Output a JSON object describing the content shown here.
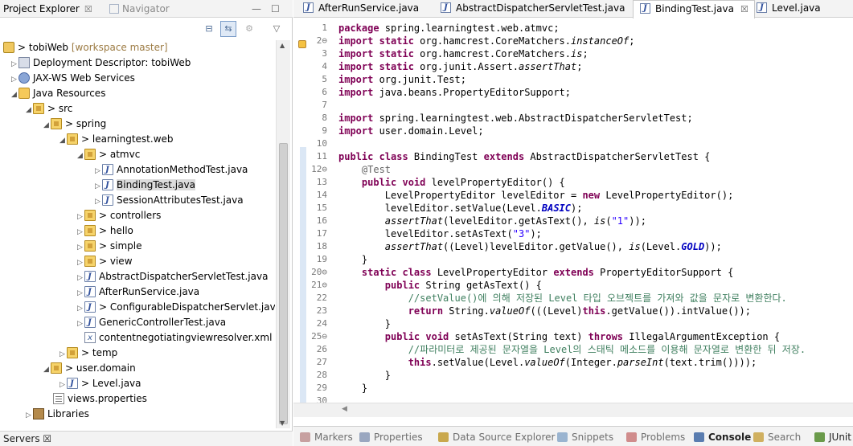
{
  "left_panel": {
    "tabs": [
      {
        "label": "Project Explorer",
        "close": "☒"
      },
      {
        "label": "Navigator"
      }
    ],
    "window_buttons": [
      "—",
      "☐"
    ],
    "tree": [
      {
        "label": "tobiWeb",
        "extra": "[workspace master]",
        "prefix": "> "
      },
      {
        "label": "Deployment Descriptor: tobiWeb"
      },
      {
        "label": "JAX-WS Web Services"
      },
      {
        "label": "Java Resources"
      },
      {
        "label": "src",
        "prefix": "> "
      },
      {
        "label": "spring",
        "prefix": "> "
      },
      {
        "label": "learningtest.web",
        "prefix": "> "
      },
      {
        "label": "atmvc",
        "prefix": "> "
      },
      {
        "label": "AnnotationMethodTest.java"
      },
      {
        "label": "BindingTest.java"
      },
      {
        "label": "SessionAttributesTest.java"
      },
      {
        "label": "controllers",
        "prefix": "> "
      },
      {
        "label": "hello",
        "prefix": "> "
      },
      {
        "label": "simple",
        "prefix": "> "
      },
      {
        "label": "view",
        "prefix": "> "
      },
      {
        "label": "AbstractDispatcherServletTest.java"
      },
      {
        "label": "AfterRunService.java"
      },
      {
        "label": "ConfigurableDispatcherServlet.java",
        "prefix": "> "
      },
      {
        "label": "GenericControllerTest.java"
      },
      {
        "label": "contentnegotiatingviewresolver.xml"
      },
      {
        "label": "temp",
        "prefix": "> "
      },
      {
        "label": "user.domain",
        "prefix": "> "
      },
      {
        "label": "Level.java",
        "prefix": "> "
      },
      {
        "label": "views.properties"
      },
      {
        "label": "Libraries"
      }
    ],
    "servers_tab": "Servers ☒"
  },
  "editor": {
    "tabs": [
      {
        "label": "AfterRunService.java"
      },
      {
        "label": "AbstractDispatcherServletTest.java"
      },
      {
        "label": "BindingTest.java",
        "close": "☒"
      },
      {
        "label": "Level.java"
      }
    ],
    "lines": [
      {
        "n": "1",
        "c": [
          [
            "kw",
            "package"
          ],
          [
            "t",
            " spring.learningtest.web.atmvc;"
          ]
        ]
      },
      {
        "n": "2⊖",
        "c": [
          [
            "kw",
            "import static"
          ],
          [
            "t",
            " org.hamcrest.CoreMatchers."
          ],
          [
            "it",
            "instanceOf"
          ],
          [
            "t",
            ";"
          ]
        ]
      },
      {
        "n": "3",
        "c": [
          [
            "kw",
            "import static"
          ],
          [
            "t",
            " org.hamcrest.CoreMatchers."
          ],
          [
            "it",
            "is"
          ],
          [
            "t",
            ";"
          ]
        ]
      },
      {
        "n": "4",
        "c": [
          [
            "kw",
            "import static"
          ],
          [
            "t",
            " org.junit.Assert."
          ],
          [
            "it",
            "assertThat"
          ],
          [
            "t",
            ";"
          ]
        ]
      },
      {
        "n": "5",
        "c": [
          [
            "kw",
            "import"
          ],
          [
            "t",
            " org.junit.Test;"
          ]
        ]
      },
      {
        "n": "6",
        "c": [
          [
            "kw",
            "import"
          ],
          [
            "t",
            " java.beans.PropertyEditorSupport;"
          ]
        ]
      },
      {
        "n": "7",
        "c": []
      },
      {
        "n": "8",
        "c": [
          [
            "kw",
            "import"
          ],
          [
            "t",
            " spring.learningtest.web.AbstractDispatcherServletTest;"
          ]
        ]
      },
      {
        "n": "9",
        "c": [
          [
            "kw",
            "import"
          ],
          [
            "t",
            " user.domain.Level;"
          ]
        ]
      },
      {
        "n": "10",
        "c": []
      },
      {
        "n": "11",
        "c": [
          [
            "kw",
            "public class"
          ],
          [
            "t",
            " BindingTest "
          ],
          [
            "kw",
            "extends"
          ],
          [
            "t",
            " AbstractDispatcherServletTest {"
          ]
        ]
      },
      {
        "n": "12⊖",
        "c": [
          [
            "t",
            "    "
          ],
          [
            "ann",
            "@Test"
          ]
        ]
      },
      {
        "n": "13",
        "c": [
          [
            "t",
            "    "
          ],
          [
            "kw",
            "public void"
          ],
          [
            "t",
            " levelPropertyEditor() {"
          ]
        ]
      },
      {
        "n": "14",
        "c": [
          [
            "t",
            "        LevelPropertyEditor levelEditor = "
          ],
          [
            "kw",
            "new"
          ],
          [
            "t",
            " LevelPropertyEditor();"
          ]
        ]
      },
      {
        "n": "15",
        "c": [
          [
            "t",
            "        levelEditor.setValue(Level."
          ],
          [
            "fld",
            "BASIC"
          ],
          [
            "t",
            ");"
          ]
        ]
      },
      {
        "n": "16",
        "c": [
          [
            "t",
            "        "
          ],
          [
            "it",
            "assertThat"
          ],
          [
            "t",
            "(levelEditor.getAsText(), "
          ],
          [
            "it",
            "is"
          ],
          [
            "t",
            "("
          ],
          [
            "str",
            "\"1\""
          ],
          [
            "t",
            "));"
          ]
        ]
      },
      {
        "n": "17",
        "c": [
          [
            "t",
            "        levelEditor.setAsText("
          ],
          [
            "str",
            "\"3\""
          ],
          [
            "t",
            ");"
          ]
        ]
      },
      {
        "n": "18",
        "c": [
          [
            "t",
            "        "
          ],
          [
            "it",
            "assertThat"
          ],
          [
            "t",
            "((Level)levelEditor.getValue(), "
          ],
          [
            "it",
            "is"
          ],
          [
            "t",
            "(Level."
          ],
          [
            "fld",
            "GOLD"
          ],
          [
            "t",
            "));"
          ]
        ]
      },
      {
        "n": "19",
        "c": [
          [
            "t",
            "    }"
          ]
        ]
      },
      {
        "n": "20⊖",
        "c": [
          [
            "t",
            "    "
          ],
          [
            "kw",
            "static class"
          ],
          [
            "t",
            " LevelPropertyEditor "
          ],
          [
            "kw",
            "extends"
          ],
          [
            "t",
            " PropertyEditorSupport {"
          ]
        ]
      },
      {
        "n": "21⊖",
        "c": [
          [
            "t",
            "        "
          ],
          [
            "kw",
            "public"
          ],
          [
            "t",
            " String getAsText() {"
          ]
        ]
      },
      {
        "n": "22",
        "c": [
          [
            "t",
            "            "
          ],
          [
            "cm",
            "//setValue()에 의해 저장된 Level 타입 오브젝트를 가져와 값을 문자로 변환한다."
          ]
        ]
      },
      {
        "n": "23",
        "c": [
          [
            "t",
            "            "
          ],
          [
            "kw",
            "return"
          ],
          [
            "t",
            " String."
          ],
          [
            "it",
            "valueOf"
          ],
          [
            "t",
            "((("
          ],
          [
            "t",
            "Level"
          ],
          [
            "t",
            ")"
          ],
          [
            "kw",
            "this"
          ],
          [
            "t",
            ".getValue()).intValue());"
          ]
        ]
      },
      {
        "n": "24",
        "c": [
          [
            "t",
            "        }"
          ]
        ]
      },
      {
        "n": "25⊖",
        "c": [
          [
            "t",
            "        "
          ],
          [
            "kw",
            "public void"
          ],
          [
            "t",
            " setAsText(String text) "
          ],
          [
            "kw",
            "throws"
          ],
          [
            "t",
            " IllegalArgumentException {"
          ]
        ]
      },
      {
        "n": "26",
        "c": [
          [
            "t",
            "            "
          ],
          [
            "cm",
            "//파라미터로 제공된 문자열을 Level의 스태틱 메소드를 이용해 문자열로 변환한 뒤 저장."
          ]
        ]
      },
      {
        "n": "27",
        "c": [
          [
            "t",
            "            "
          ],
          [
            "kw",
            "this"
          ],
          [
            "t",
            ".setValue(Level."
          ],
          [
            "it",
            "valueOf"
          ],
          [
            "t",
            "(Integer."
          ],
          [
            "it",
            "parseInt"
          ],
          [
            "t",
            "(text.trim())));"
          ]
        ]
      },
      {
        "n": "28",
        "c": [
          [
            "t",
            "        }"
          ]
        ]
      },
      {
        "n": "29",
        "c": [
          [
            "t",
            "    }"
          ]
        ]
      },
      {
        "n": "30",
        "c": []
      }
    ]
  },
  "bottom_tabs": [
    {
      "label": "Markers",
      "style": "normal",
      "color": "#c7a0a0"
    },
    {
      "label": "Properties",
      "style": "normal",
      "color": "#9aa7c0"
    },
    {
      "label": "Data Source Explorer",
      "style": "normal",
      "color": "#c9a84d"
    },
    {
      "label": "Snippets",
      "style": "normal",
      "color": "#9ab4d0"
    },
    {
      "label": "Problems",
      "style": "normal",
      "color": "#d08c8c"
    },
    {
      "label": "Console",
      "style": "bold",
      "color": "#5a7db0"
    },
    {
      "label": "Search",
      "style": "normal",
      "color": "#d0b060"
    },
    {
      "label": "JUnit",
      "style": "dark",
      "color": "#6a9a4a"
    }
  ]
}
